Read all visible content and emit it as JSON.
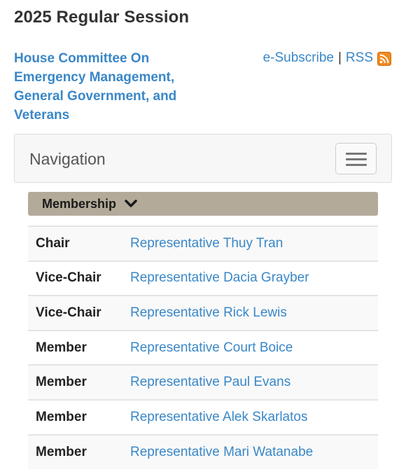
{
  "session_title": "2025 Regular Session",
  "committee_name": "House Committee On Emergency Management, General Government, and Veterans",
  "subscribe": {
    "esubscribe_label": "e-Subscribe",
    "separator": "|",
    "rss_label": "RSS"
  },
  "navigation": {
    "title": "Navigation"
  },
  "section": {
    "label": "Membership"
  },
  "members": [
    {
      "role": "Chair",
      "name": "Representative Thuy Tran"
    },
    {
      "role": "Vice-Chair",
      "name": "Representative Dacia Grayber"
    },
    {
      "role": "Vice-Chair",
      "name": "Representative Rick Lewis"
    },
    {
      "role": "Member",
      "name": "Representative Court Boice"
    },
    {
      "role": "Member",
      "name": "Representative Paul Evans"
    },
    {
      "role": "Member",
      "name": "Representative Alek Skarlatos"
    },
    {
      "role": "Member",
      "name": "Representative Mari Watanabe"
    }
  ],
  "colors": {
    "link": "#3a87c7",
    "section_header": "#b3aa9a",
    "rss_orange": "#f28a1f"
  },
  "icons": {
    "rss": "rss-icon",
    "menu": "hamburger-menu-icon",
    "expand": "chevron-down-icon"
  }
}
